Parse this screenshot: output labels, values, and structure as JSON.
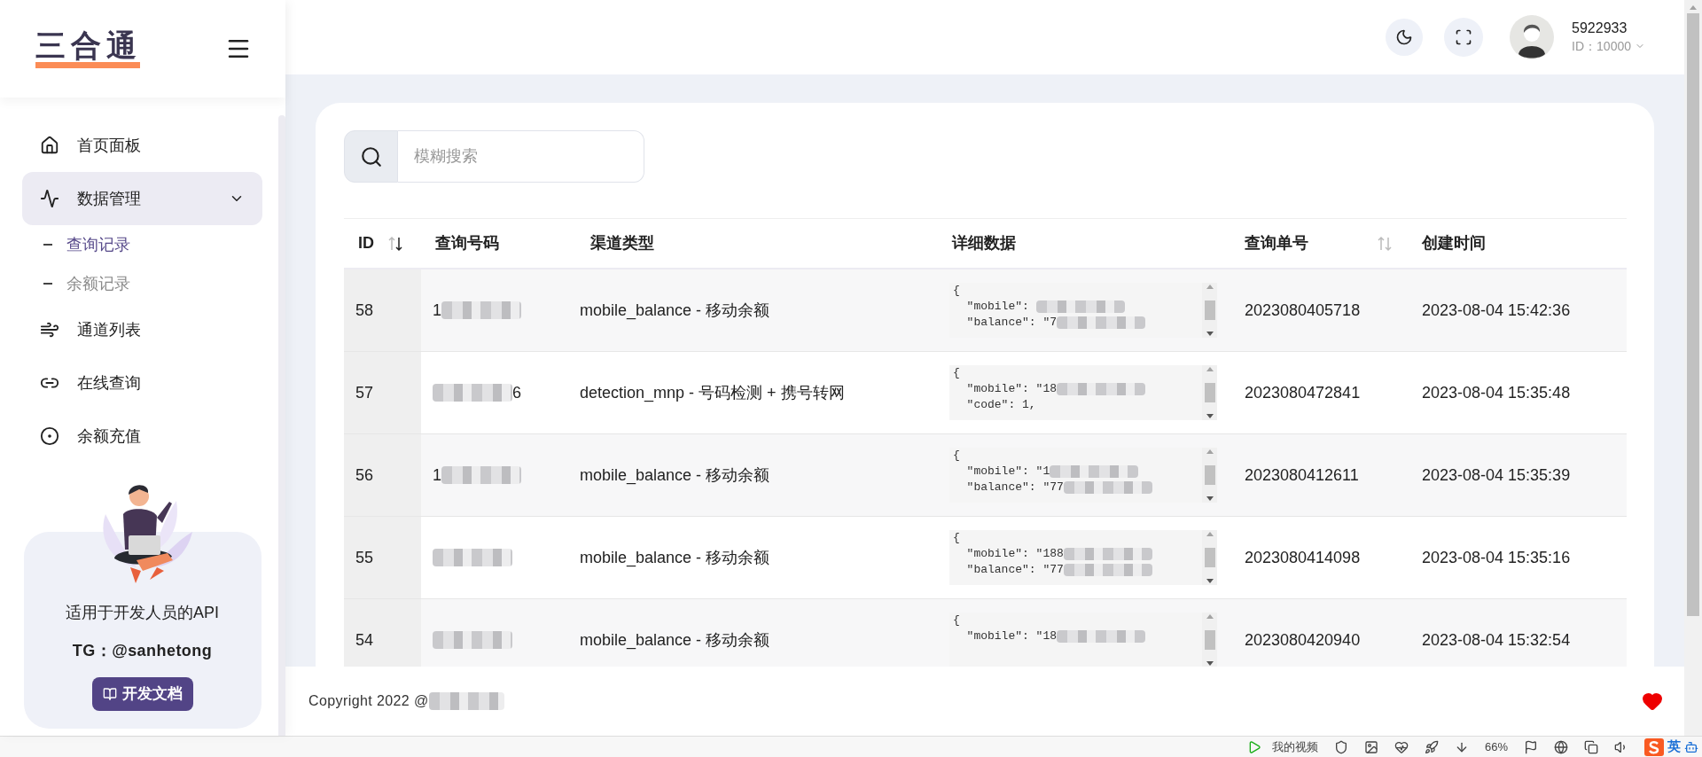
{
  "logo": {
    "text": "三合通"
  },
  "nav": [
    {
      "label": "首页面板",
      "selected": false
    },
    {
      "label": "数据管理",
      "selected": true,
      "expanded": true,
      "children": [
        {
          "label": "查询记录",
          "selected": true
        },
        {
          "label": "余额记录",
          "selected": false
        }
      ]
    },
    {
      "label": "通道列表",
      "selected": false
    },
    {
      "label": "在线查询",
      "selected": false
    },
    {
      "label": "余额充值",
      "selected": false
    }
  ],
  "promo": {
    "title": "适用于开发人员的API",
    "contact": "TG：@sanhetong",
    "button": "开发文档"
  },
  "user": {
    "name": "5922933",
    "id": "ID：10000"
  },
  "search": {
    "placeholder": "模糊搜索"
  },
  "table": {
    "columns": [
      {
        "label": "ID",
        "sortable": true
      },
      {
        "label": "查询号码",
        "sortable": false
      },
      {
        "label": "渠道类型",
        "sortable": false
      },
      {
        "label": "详细数据",
        "sortable": false
      },
      {
        "label": "查询单号",
        "sortable": true
      },
      {
        "label": "创建时间",
        "sortable": false
      }
    ],
    "rows": [
      {
        "id": "58",
        "phone": [
          {
            "kind": "text",
            "text": "1"
          },
          {
            "kind": "blur"
          }
        ],
        "channel": "mobile_balance - 移动余额",
        "detail": [
          [
            {
              "kind": "text",
              "text": "{"
            }
          ],
          [
            {
              "kind": "text",
              "text": "  \"mobile\": "
            },
            {
              "kind": "blur"
            }
          ],
          [
            {
              "kind": "text",
              "text": "  \"balance\": \"7"
            },
            {
              "kind": "blur"
            }
          ]
        ],
        "order": "2023080405718",
        "created": "2023-08-04 15:42:36"
      },
      {
        "id": "57",
        "phone": [
          {
            "kind": "blur"
          },
          {
            "kind": "text",
            "text": "6"
          }
        ],
        "channel": "detection_mnp - 号码检测 + 携号转网",
        "detail": [
          [
            {
              "kind": "text",
              "text": "{"
            }
          ],
          [
            {
              "kind": "text",
              "text": "  \"mobile\": \"18"
            },
            {
              "kind": "blur"
            }
          ],
          [
            {
              "kind": "text",
              "text": "  \"code\": 1,"
            }
          ]
        ],
        "order": "2023080472841",
        "created": "2023-08-04 15:35:48"
      },
      {
        "id": "56",
        "phone": [
          {
            "kind": "text",
            "text": "1"
          },
          {
            "kind": "blur"
          }
        ],
        "channel": "mobile_balance - 移动余额",
        "detail": [
          [
            {
              "kind": "text",
              "text": "{"
            }
          ],
          [
            {
              "kind": "text",
              "text": "  \"mobile\": \"1"
            },
            {
              "kind": "blur"
            }
          ],
          [
            {
              "kind": "text",
              "text": "  \"balance\": \"77"
            },
            {
              "kind": "blur"
            }
          ]
        ],
        "order": "2023080412611",
        "created": "2023-08-04 15:35:39"
      },
      {
        "id": "55",
        "phone": [
          {
            "kind": "blur"
          }
        ],
        "channel": "mobile_balance - 移动余额",
        "detail": [
          [
            {
              "kind": "text",
              "text": "{"
            }
          ],
          [
            {
              "kind": "text",
              "text": "  \"mobile\": \"188"
            },
            {
              "kind": "blur"
            }
          ],
          [
            {
              "kind": "text",
              "text": "  \"balance\": \"77"
            },
            {
              "kind": "blur"
            }
          ]
        ],
        "order": "2023080414098",
        "created": "2023-08-04 15:35:16"
      },
      {
        "id": "54",
        "phone": [
          {
            "kind": "blur"
          }
        ],
        "channel": "mobile_balance - 移动余额",
        "detail": [
          [
            {
              "kind": "text",
              "text": "{"
            }
          ],
          [
            {
              "kind": "text",
              "text": "  \"mobile\": \"18"
            },
            {
              "kind": "blur"
            }
          ]
        ],
        "order": "2023080420940",
        "created": "2023-08-04 15:32:54"
      }
    ]
  },
  "footer": {
    "copyright": "Copyright 2022 @"
  },
  "status_bar": {
    "video": "我的视频",
    "zoom": "66%",
    "ime": "英"
  }
}
